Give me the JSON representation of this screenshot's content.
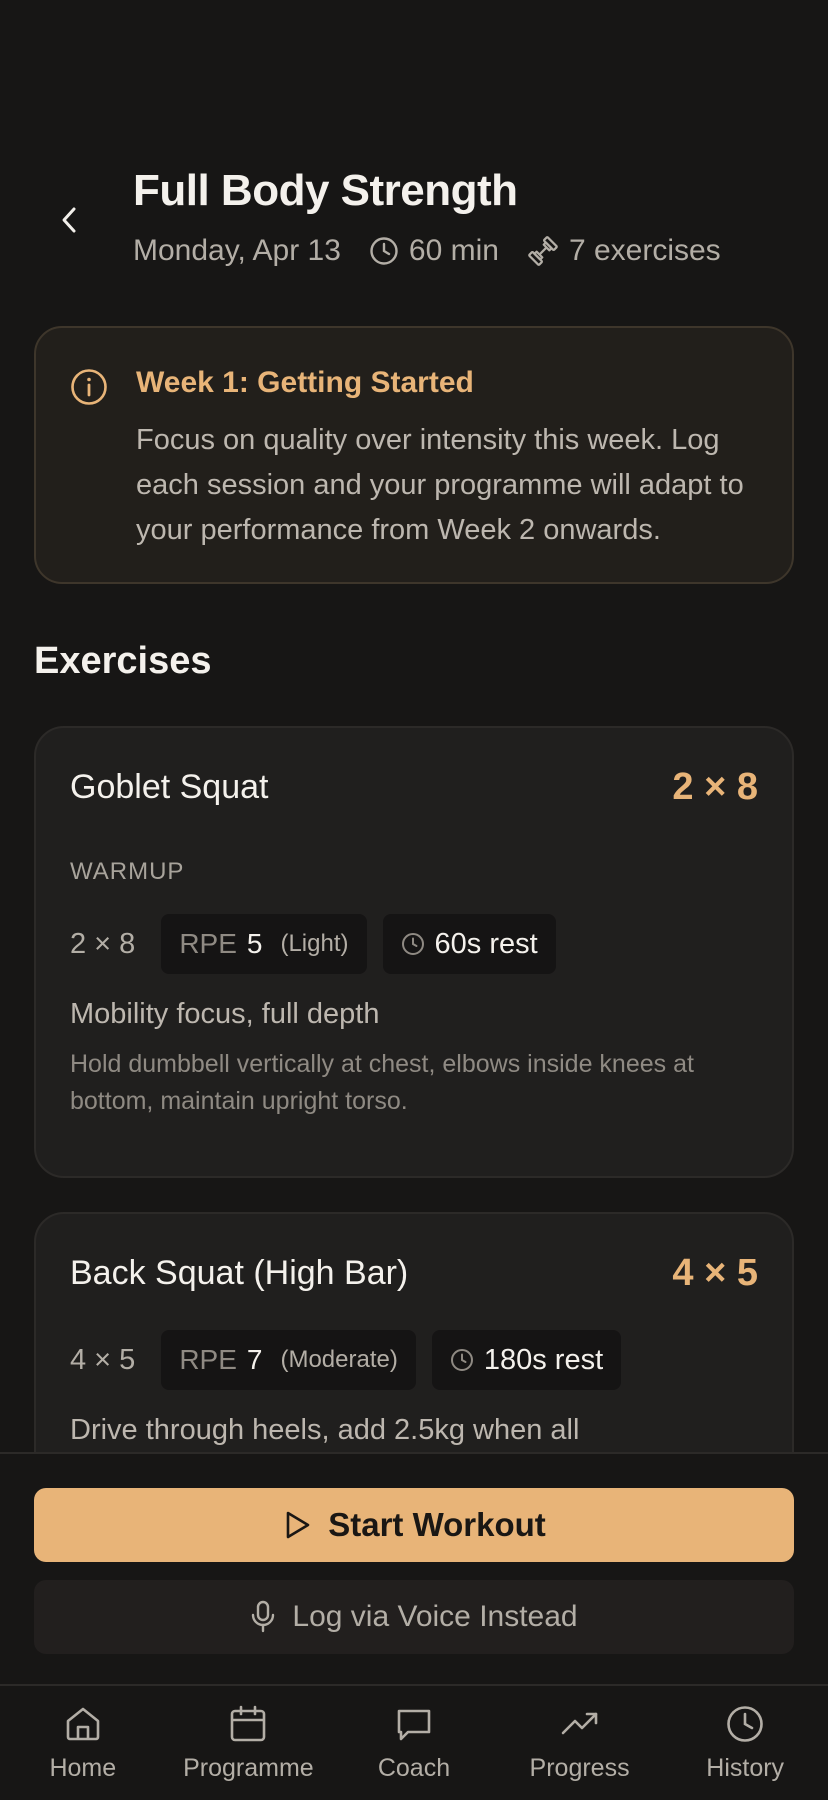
{
  "header": {
    "title": "Full Body Strength",
    "date": "Monday, Apr 13",
    "duration": "60 min",
    "exercise_count": "7 exercises"
  },
  "info": {
    "title": "Week 1: Getting Started",
    "body": "Focus on quality over intensity this week. Log each session and your programme will adapt to your performance from Week 2 onwards."
  },
  "section_title": "Exercises",
  "exercises": [
    {
      "name": "Goblet Squat",
      "sets_reps": "2 × 8",
      "tag": "WARMUP",
      "sets_plain": "2 × 8",
      "rpe_label": "RPE",
      "rpe_value": "5",
      "rpe_desc": "(Light)",
      "rest": "60s rest",
      "note": "Mobility focus, full depth",
      "detail": "Hold dumbbell vertically at chest, elbows inside knees at bottom, maintain upright torso."
    },
    {
      "name": "Back Squat (High Bar)",
      "sets_reps": "4 × 5",
      "sets_plain": "4 × 5",
      "rpe_label": "RPE",
      "rpe_value": "7",
      "rpe_desc": "(Moderate)",
      "rest": "180s rest",
      "note": "Drive through heels, add 2.5kg when all"
    }
  ],
  "actions": {
    "start": "Start Workout",
    "voice": "Log via Voice Instead"
  },
  "tabs": [
    {
      "label": "Home",
      "icon": "home-icon"
    },
    {
      "label": "Programme",
      "icon": "calendar-icon"
    },
    {
      "label": "Coach",
      "icon": "chat-icon"
    },
    {
      "label": "Progress",
      "icon": "trend-icon"
    },
    {
      "label": "History",
      "icon": "clock-icon"
    }
  ],
  "colors": {
    "background": "#171615",
    "accent": "#e8b478",
    "card": "#201f1e",
    "info_card": "#221f1b"
  }
}
